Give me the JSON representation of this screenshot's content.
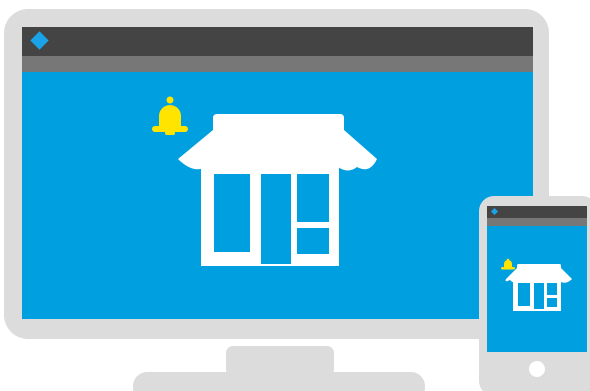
{
  "illustration": {
    "devices": [
      "desktop-monitor",
      "smartphone"
    ],
    "icons": [
      "store-icon",
      "bell-icon",
      "diamond-logo-icon"
    ]
  },
  "colors": {
    "device_frame": "#dcdcdc",
    "title_bar": "#444444",
    "tool_bar": "#777777",
    "screen": "#009fdf",
    "accent_logo": "#1aa3e8",
    "bell": "#ffe400",
    "store": "#ffffff",
    "home_button": "#ffffff"
  }
}
